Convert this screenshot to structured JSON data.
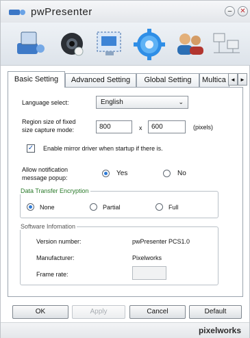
{
  "window": {
    "title": "pwPresenter"
  },
  "titlebar": {
    "minimize_glyph": "–",
    "close_glyph": "✕"
  },
  "toolbar": {
    "tools": [
      "presenter-icon",
      "camera-icon",
      "screen-capture-icon",
      "settings-gear-icon",
      "users-icon",
      "network-icon"
    ]
  },
  "tabs": [
    {
      "label": "Basic Setting"
    },
    {
      "label": "Advanced Setting"
    },
    {
      "label": "Global Setting"
    },
    {
      "label": "Multica"
    }
  ],
  "tab_scroll": {
    "left": "◄",
    "right": "►"
  },
  "basic": {
    "language_label": "Language select:",
    "language_value": "English",
    "region_label_1": "Region size of fixed",
    "region_label_2": "size capture mode:",
    "width_value": "800",
    "x_sep": "x",
    "height_value": "600",
    "units": "(pixels)",
    "mirror_label": "Enable mirror driver when startup if there is.",
    "mirror_checked": true,
    "notify_label_1": "Allow notification",
    "notify_label_2": "message popup:",
    "notify_yes": "Yes",
    "notify_no": "No",
    "encryption_title": "Data Transfer Encryption",
    "enc_none": "None",
    "enc_partial": "Partial",
    "enc_full": "Full",
    "software_title": "Software Infomation",
    "version_label": "Version number:",
    "version_value": "pwPresenter PCS1.0",
    "manufacturer_label": "Manufacturer:",
    "manufacturer_value": "Pixelworks",
    "framerate_label": "Frame rate:",
    "framerate_value": ""
  },
  "buttons": {
    "ok": "OK",
    "apply": "Apply",
    "cancel": "Cancel",
    "default": "Default"
  },
  "footer": {
    "brand": "pixelworks"
  }
}
